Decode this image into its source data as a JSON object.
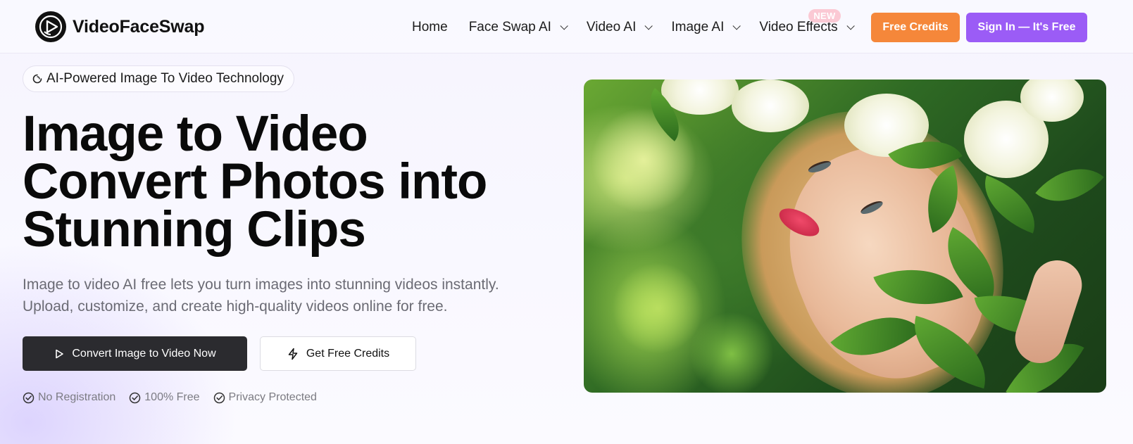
{
  "brand": {
    "name": "VideoFaceSwap"
  },
  "nav": {
    "items": [
      {
        "label": "Home",
        "has_dropdown": false
      },
      {
        "label": "Face Swap AI",
        "has_dropdown": true
      },
      {
        "label": "Video AI",
        "has_dropdown": true
      },
      {
        "label": "Image AI",
        "has_dropdown": true
      },
      {
        "label": "Video Effects",
        "has_dropdown": true,
        "badge": "NEW"
      }
    ],
    "free_credits_label": "Free Credits",
    "sign_in_label": "Sign In — It's Free"
  },
  "hero": {
    "pill_label": "AI-Powered Image To Video Technology",
    "headline_lines": [
      "Image to Video",
      "Convert Photos into",
      "Stunning Clips"
    ],
    "subtitle_lines": [
      "Image to video AI free lets you turn images into stunning videos instantly.",
      "Upload, customize, and create high-quality videos online for free."
    ],
    "primary_cta": "Convert Image to Video Now",
    "secondary_cta": "Get Free Credits",
    "features": [
      "No Registration",
      "100% Free",
      "Privacy Protected"
    ],
    "image_icon": "hero-photo-woman-flowers"
  },
  "colors": {
    "orange": "#f5873a",
    "purple": "#9b5cf6",
    "dark_button": "#2b2b2f",
    "badge_new": "#fbc9d4"
  }
}
